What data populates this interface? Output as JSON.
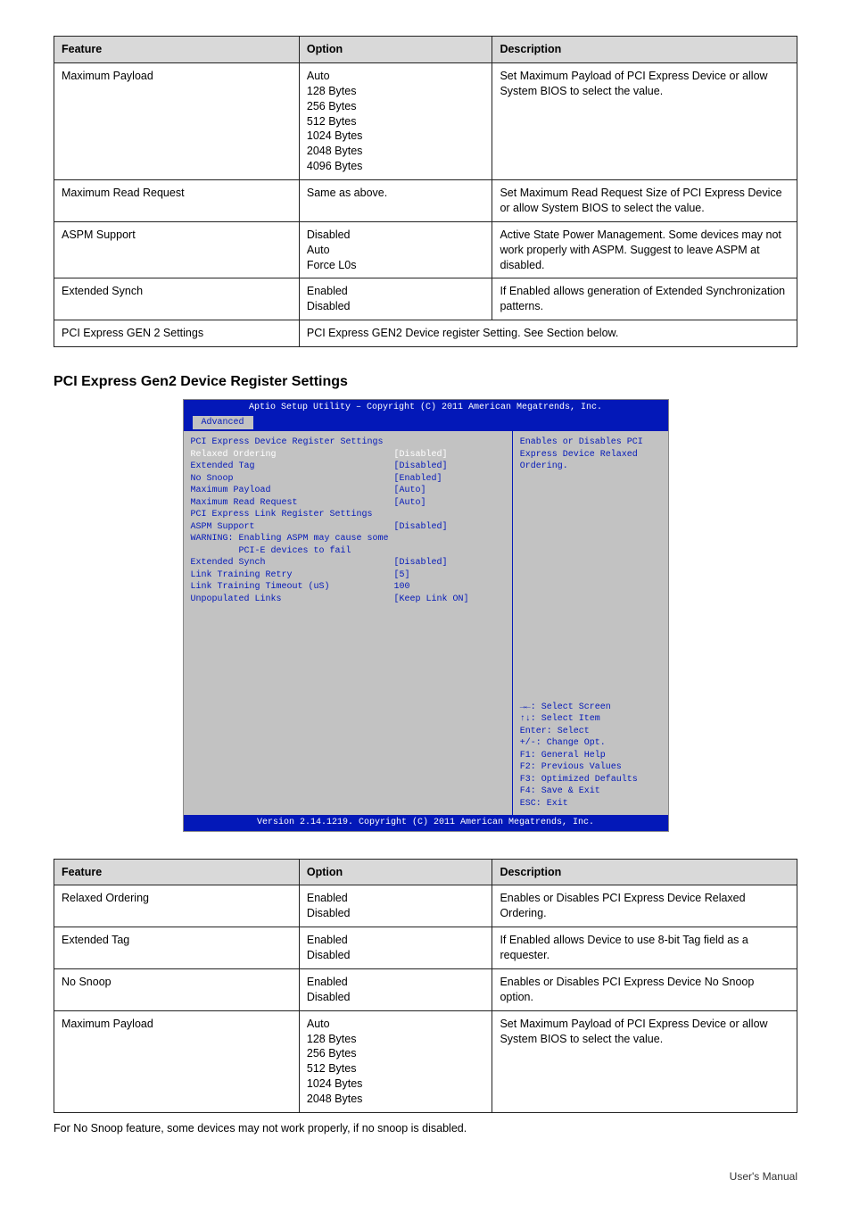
{
  "table1": {
    "headers": [
      "Feature",
      "Option",
      "Description"
    ],
    "rows": [
      {
        "feature": "Maximum Payload",
        "options": "Auto\n128 Bytes\n256 Bytes\n512 Bytes\n1024 Bytes\n2048 Bytes\n4096 Bytes",
        "description": "Set Maximum Payload of PCI Express Device or allow System BIOS to select the value."
      },
      {
        "feature": "Maximum Read Request",
        "options": "Same as above.",
        "description": "Set Maximum Read Request Size of PCI Express Device or allow System BIOS to select the value."
      },
      {
        "feature": "ASPM Support",
        "options": "Disabled\nAuto\nForce L0s",
        "description": "Active State Power Management. Some devices may not work properly with ASPM. Suggest to leave ASPM at disabled."
      },
      {
        "feature": "Extended Synch",
        "options": "Enabled\nDisabled",
        "description": "If Enabled allows generation of Extended Synchronization patterns."
      },
      {
        "feature": "PCI Express GEN 2 Settings",
        "options_span": "PCI Express GEN2 Device register Setting. See Section below."
      }
    ]
  },
  "section_title": "PCI Express Gen2 Device Register Settings",
  "bios": {
    "title": "Aptio Setup Utility – Copyright (C) 2011 American Megatrends, Inc.",
    "tab": "Advanced",
    "help_top": "Enables or Disables PCI\nExpress Device Relaxed\nOrdering.",
    "lines": [
      {
        "label": "PCI Express Device Register Settings",
        "value": "",
        "cls": "bios-blue"
      },
      {
        "label": "Relaxed Ordering",
        "value": "[Disabled]",
        "cls": "bios-white"
      },
      {
        "label": "Extended Tag",
        "value": "[Disabled]",
        "cls": "bios-blue"
      },
      {
        "label": "No Snoop",
        "value": "[Enabled]",
        "cls": "bios-blue"
      },
      {
        "label": "Maximum Payload",
        "value": "[Auto]",
        "cls": "bios-blue"
      },
      {
        "label": "Maximum Read Request",
        "value": "[Auto]",
        "cls": "bios-blue"
      },
      {
        "label": "",
        "value": "",
        "cls": ""
      },
      {
        "label": "PCI Express Link Register Settings",
        "value": "",
        "cls": "bios-blue"
      },
      {
        "label": "ASPM Support",
        "value": "[Disabled]",
        "cls": "bios-blue"
      },
      {
        "label": "WARNING: Enabling ASPM may cause some",
        "value": "",
        "cls": "bios-blue"
      },
      {
        "label": "         PCI-E devices to fail",
        "value": "",
        "cls": "bios-blue"
      },
      {
        "label": "Extended Synch",
        "value": "[Disabled]",
        "cls": "bios-blue"
      },
      {
        "label": "",
        "value": "",
        "cls": ""
      },
      {
        "label": "Link Training Retry",
        "value": "[5]",
        "cls": "bios-blue"
      },
      {
        "label": "Link Training Timeout (uS)",
        "value": "100",
        "cls": "bios-blue"
      },
      {
        "label": "Unpopulated Links",
        "value": "[Keep Link ON]",
        "cls": "bios-blue"
      }
    ],
    "help_keys": "→←: Select Screen\n↑↓: Select Item\nEnter: Select\n+/-: Change Opt.\nF1: General Help\nF2: Previous Values\nF3: Optimized Defaults\nF4: Save & Exit\nESC: Exit",
    "footer": "Version 2.14.1219. Copyright (C) 2011 American Megatrends, Inc."
  },
  "table2": {
    "headers": [
      "Feature",
      "Option",
      "Description"
    ],
    "rows": [
      {
        "feature": "Relaxed Ordering",
        "options": "Enabled\nDisabled",
        "description": "Enables or Disables PCI Express Device Relaxed Ordering."
      },
      {
        "feature": "Extended Tag",
        "options": "Enabled\nDisabled",
        "description": "If Enabled allows Device to use 8-bit Tag field as a requester."
      },
      {
        "feature": "No Snoop",
        "options": "Enabled\nDisabled",
        "description": "Enables or Disables PCI Express Device No Snoop option."
      },
      {
        "feature": "Maximum Payload",
        "options": "Auto\n128 Bytes\n256 Bytes\n512 Bytes\n1024 Bytes\n2048 Bytes",
        "description": "Set Maximum Payload of PCI Express Device or allow System BIOS to select the value."
      }
    ]
  },
  "nosnoop_text": "For No Snoop feature, some devices may not work properly, if no snoop is disabled.",
  "user_manual": "User's Manual"
}
